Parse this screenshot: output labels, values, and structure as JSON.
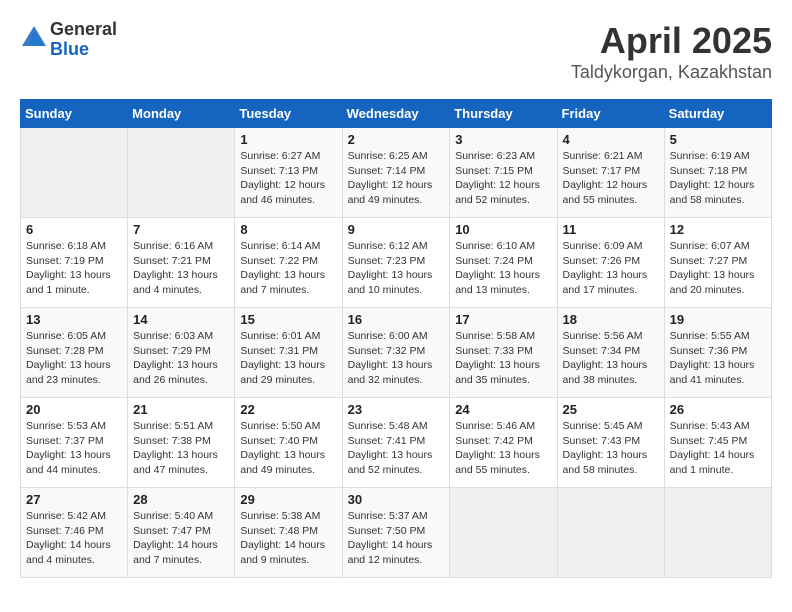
{
  "header": {
    "logo": {
      "general": "General",
      "blue": "Blue"
    },
    "title": "April 2025",
    "subtitle": "Taldykorgan, Kazakhstan"
  },
  "weekdays": [
    "Sunday",
    "Monday",
    "Tuesday",
    "Wednesday",
    "Thursday",
    "Friday",
    "Saturday"
  ],
  "weeks": [
    [
      {
        "day": null
      },
      {
        "day": null
      },
      {
        "day": "1",
        "sunrise": "Sunrise: 6:27 AM",
        "sunset": "Sunset: 7:13 PM",
        "daylight": "Daylight: 12 hours and 46 minutes."
      },
      {
        "day": "2",
        "sunrise": "Sunrise: 6:25 AM",
        "sunset": "Sunset: 7:14 PM",
        "daylight": "Daylight: 12 hours and 49 minutes."
      },
      {
        "day": "3",
        "sunrise": "Sunrise: 6:23 AM",
        "sunset": "Sunset: 7:15 PM",
        "daylight": "Daylight: 12 hours and 52 minutes."
      },
      {
        "day": "4",
        "sunrise": "Sunrise: 6:21 AM",
        "sunset": "Sunset: 7:17 PM",
        "daylight": "Daylight: 12 hours and 55 minutes."
      },
      {
        "day": "5",
        "sunrise": "Sunrise: 6:19 AM",
        "sunset": "Sunset: 7:18 PM",
        "daylight": "Daylight: 12 hours and 58 minutes."
      }
    ],
    [
      {
        "day": "6",
        "sunrise": "Sunrise: 6:18 AM",
        "sunset": "Sunset: 7:19 PM",
        "daylight": "Daylight: 13 hours and 1 minute."
      },
      {
        "day": "7",
        "sunrise": "Sunrise: 6:16 AM",
        "sunset": "Sunset: 7:21 PM",
        "daylight": "Daylight: 13 hours and 4 minutes."
      },
      {
        "day": "8",
        "sunrise": "Sunrise: 6:14 AM",
        "sunset": "Sunset: 7:22 PM",
        "daylight": "Daylight: 13 hours and 7 minutes."
      },
      {
        "day": "9",
        "sunrise": "Sunrise: 6:12 AM",
        "sunset": "Sunset: 7:23 PM",
        "daylight": "Daylight: 13 hours and 10 minutes."
      },
      {
        "day": "10",
        "sunrise": "Sunrise: 6:10 AM",
        "sunset": "Sunset: 7:24 PM",
        "daylight": "Daylight: 13 hours and 13 minutes."
      },
      {
        "day": "11",
        "sunrise": "Sunrise: 6:09 AM",
        "sunset": "Sunset: 7:26 PM",
        "daylight": "Daylight: 13 hours and 17 minutes."
      },
      {
        "day": "12",
        "sunrise": "Sunrise: 6:07 AM",
        "sunset": "Sunset: 7:27 PM",
        "daylight": "Daylight: 13 hours and 20 minutes."
      }
    ],
    [
      {
        "day": "13",
        "sunrise": "Sunrise: 6:05 AM",
        "sunset": "Sunset: 7:28 PM",
        "daylight": "Daylight: 13 hours and 23 minutes."
      },
      {
        "day": "14",
        "sunrise": "Sunrise: 6:03 AM",
        "sunset": "Sunset: 7:29 PM",
        "daylight": "Daylight: 13 hours and 26 minutes."
      },
      {
        "day": "15",
        "sunrise": "Sunrise: 6:01 AM",
        "sunset": "Sunset: 7:31 PM",
        "daylight": "Daylight: 13 hours and 29 minutes."
      },
      {
        "day": "16",
        "sunrise": "Sunrise: 6:00 AM",
        "sunset": "Sunset: 7:32 PM",
        "daylight": "Daylight: 13 hours and 32 minutes."
      },
      {
        "day": "17",
        "sunrise": "Sunrise: 5:58 AM",
        "sunset": "Sunset: 7:33 PM",
        "daylight": "Daylight: 13 hours and 35 minutes."
      },
      {
        "day": "18",
        "sunrise": "Sunrise: 5:56 AM",
        "sunset": "Sunset: 7:34 PM",
        "daylight": "Daylight: 13 hours and 38 minutes."
      },
      {
        "day": "19",
        "sunrise": "Sunrise: 5:55 AM",
        "sunset": "Sunset: 7:36 PM",
        "daylight": "Daylight: 13 hours and 41 minutes."
      }
    ],
    [
      {
        "day": "20",
        "sunrise": "Sunrise: 5:53 AM",
        "sunset": "Sunset: 7:37 PM",
        "daylight": "Daylight: 13 hours and 44 minutes."
      },
      {
        "day": "21",
        "sunrise": "Sunrise: 5:51 AM",
        "sunset": "Sunset: 7:38 PM",
        "daylight": "Daylight: 13 hours and 47 minutes."
      },
      {
        "day": "22",
        "sunrise": "Sunrise: 5:50 AM",
        "sunset": "Sunset: 7:40 PM",
        "daylight": "Daylight: 13 hours and 49 minutes."
      },
      {
        "day": "23",
        "sunrise": "Sunrise: 5:48 AM",
        "sunset": "Sunset: 7:41 PM",
        "daylight": "Daylight: 13 hours and 52 minutes."
      },
      {
        "day": "24",
        "sunrise": "Sunrise: 5:46 AM",
        "sunset": "Sunset: 7:42 PM",
        "daylight": "Daylight: 13 hours and 55 minutes."
      },
      {
        "day": "25",
        "sunrise": "Sunrise: 5:45 AM",
        "sunset": "Sunset: 7:43 PM",
        "daylight": "Daylight: 13 hours and 58 minutes."
      },
      {
        "day": "26",
        "sunrise": "Sunrise: 5:43 AM",
        "sunset": "Sunset: 7:45 PM",
        "daylight": "Daylight: 14 hours and 1 minute."
      }
    ],
    [
      {
        "day": "27",
        "sunrise": "Sunrise: 5:42 AM",
        "sunset": "Sunset: 7:46 PM",
        "daylight": "Daylight: 14 hours and 4 minutes."
      },
      {
        "day": "28",
        "sunrise": "Sunrise: 5:40 AM",
        "sunset": "Sunset: 7:47 PM",
        "daylight": "Daylight: 14 hours and 7 minutes."
      },
      {
        "day": "29",
        "sunrise": "Sunrise: 5:38 AM",
        "sunset": "Sunset: 7:48 PM",
        "daylight": "Daylight: 14 hours and 9 minutes."
      },
      {
        "day": "30",
        "sunrise": "Sunrise: 5:37 AM",
        "sunset": "Sunset: 7:50 PM",
        "daylight": "Daylight: 14 hours and 12 minutes."
      },
      {
        "day": null
      },
      {
        "day": null
      },
      {
        "day": null
      }
    ]
  ]
}
